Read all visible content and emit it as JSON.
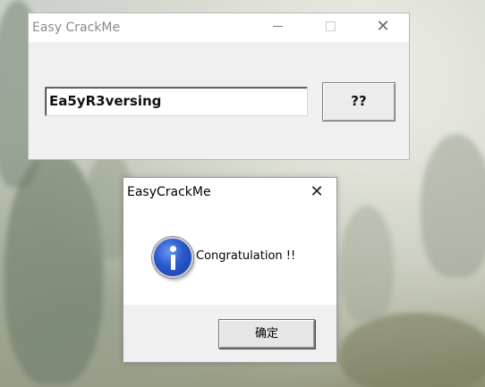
{
  "main_window": {
    "title": "Easy CrackMe",
    "controls": {
      "minimize": "—",
      "maximize": "☐",
      "close": "✕"
    },
    "serial_input": {
      "value": "Ea5yR3versing"
    },
    "check_button_label": "??"
  },
  "message_box": {
    "title": "EasyCrackMe",
    "close": "✕",
    "icon": "info-icon",
    "message": "Congratulation !!",
    "ok_button_label": "确定"
  }
}
